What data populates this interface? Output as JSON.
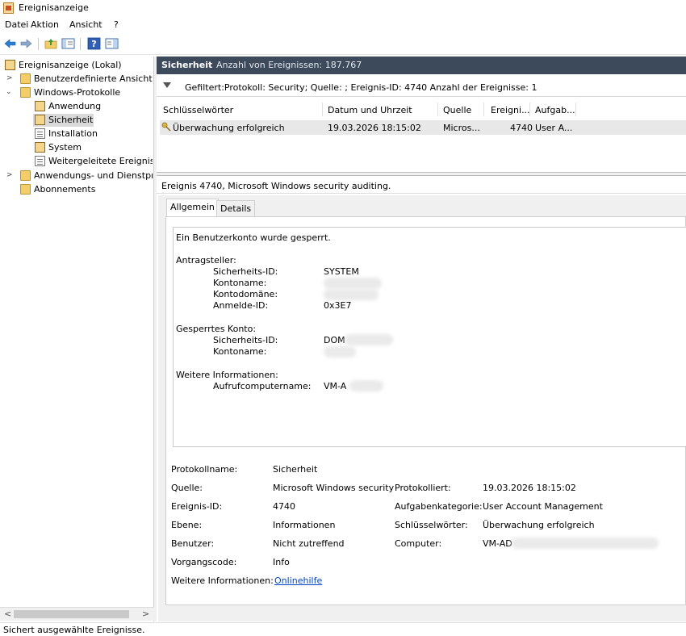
{
  "window": {
    "title": "Ereignisanzeige"
  },
  "menu": {
    "items": [
      "Datei",
      "Aktion",
      "Ansicht",
      "?"
    ]
  },
  "toolbar": {
    "icons": [
      "back-arrow-icon",
      "forward-arrow-icon",
      "folder-up-icon",
      "show-hide-tree-icon",
      "help-icon",
      "action-pane-icon"
    ]
  },
  "tree": {
    "items": [
      {
        "label": "Ereignisanzeige (Lokal)"
      },
      {
        "label": "Benutzerdefinierte Ansichten"
      },
      {
        "label": "Windows-Protokolle"
      },
      {
        "label": "Anwendung"
      },
      {
        "label": "Sicherheit"
      },
      {
        "label": "Installation"
      },
      {
        "label": "System"
      },
      {
        "label": "Weitergeleitete Ereignisse"
      },
      {
        "label": "Anwendungs- und Dienstprotokolle"
      },
      {
        "label": "Abonnements"
      }
    ],
    "selected": "Sicherheit"
  },
  "log_header": {
    "title": "Sicherheit",
    "count": "Anzahl von Ereignissen: 187.767"
  },
  "filter": {
    "text": "Gefiltert:Protokoll: Security; Quelle: ; Ereignis-ID: 4740 Anzahl der Ereignisse: 1"
  },
  "event_list": {
    "columns": [
      "Schlüsselwörter",
      "Datum und Uhrzeit",
      "Quelle",
      "Ereigni...",
      "Aufgab..."
    ],
    "rows": [
      {
        "keywords": "Überwachung erfolgreich",
        "datetime": "19.03.2026 18:15:02",
        "source": "Micros...",
        "event_id": "4740",
        "task": "User A..."
      }
    ]
  },
  "detail": {
    "title": "Ereignis 4740, Microsoft Windows security auditing.",
    "tabs": [
      "Allgemein",
      "Details"
    ],
    "description": {
      "line1": "Ein Benutzerkonto wurde gesperrt.",
      "requester_heading": "Antragsteller:",
      "requester": [
        {
          "label": "Sicherheits-ID:",
          "value": "SYSTEM"
        },
        {
          "label": "Kontoname:",
          "value": ""
        },
        {
          "label": "Kontodomäne:",
          "value": ""
        },
        {
          "label": "Anmelde-ID:",
          "value": "0x3E7"
        }
      ],
      "locked_heading": "Gesperrtes Konto:",
      "locked": [
        {
          "label": "Sicherheits-ID:",
          "value": "DOM"
        },
        {
          "label": "Kontoname:",
          "value": ""
        }
      ],
      "more_heading": "Weitere Informationen:",
      "more": [
        {
          "label": "Aufrufcomputername:",
          "value": "VM-A"
        }
      ]
    },
    "properties": {
      "protokollname_label": "Protokollname:",
      "protokollname": "Sicherheit",
      "quelle_label": "Quelle:",
      "quelle": "Microsoft Windows security",
      "protokolliert_label": "Protokolliert:",
      "protokolliert": "19.03.2026 18:15:02",
      "ereignis_label": "Ereignis-ID:",
      "ereignis": "4740",
      "aufgabe_label": "Aufgabenkategorie:",
      "aufgabe": "User Account Management",
      "ebene_label": "Ebene:",
      "ebene": "Informationen",
      "schluessel_label": "Schlüsselwörter:",
      "schluessel": "Überwachung erfolgreich",
      "benutzer_label": "Benutzer:",
      "benutzer": "Nicht zutreffend",
      "computer_label": "Computer:",
      "computer": "VM-AD",
      "vorgang_label": "Vorgangscode:",
      "vorgang": "Info",
      "weitere_label": "Weitere Informationen:",
      "weitere_link": "Onlinehilfe"
    }
  },
  "status": {
    "text": "Sichert ausgewählte Ereignisse."
  }
}
